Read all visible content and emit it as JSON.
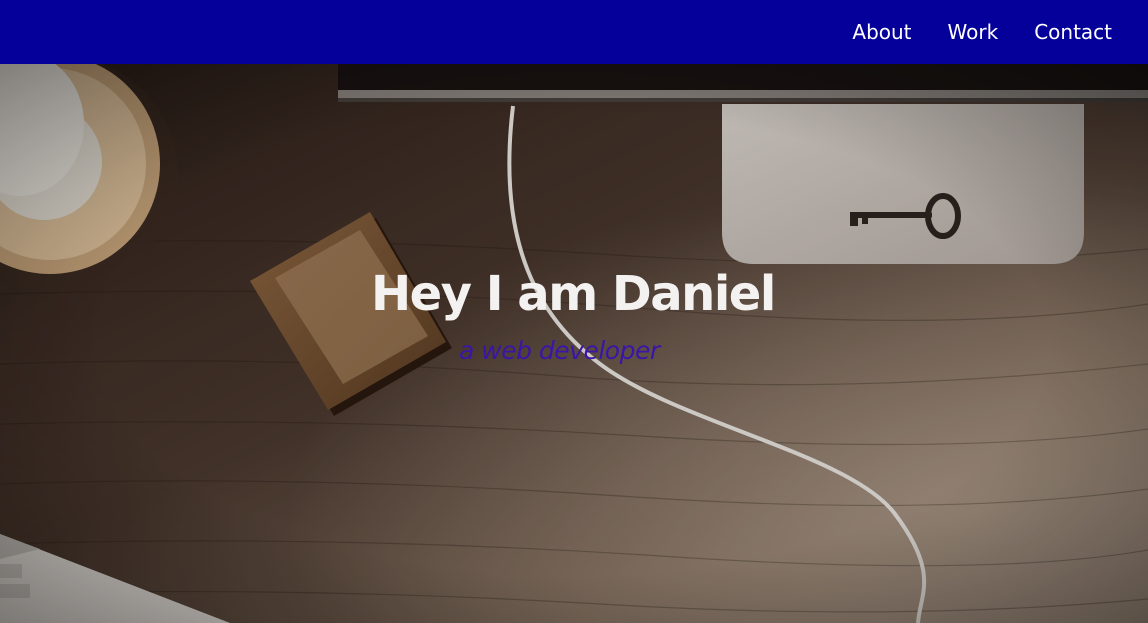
{
  "nav": {
    "links": [
      {
        "label": "About"
      },
      {
        "label": "Work"
      },
      {
        "label": "Contact"
      }
    ]
  },
  "hero": {
    "title": "Hey I am Daniel",
    "subtitle": "a web developer"
  },
  "colors": {
    "navbar_bg": "#06009b",
    "nav_text": "#ffffff",
    "title_text": "#f4f2f1",
    "subtitle_text": "#3a15a8"
  }
}
